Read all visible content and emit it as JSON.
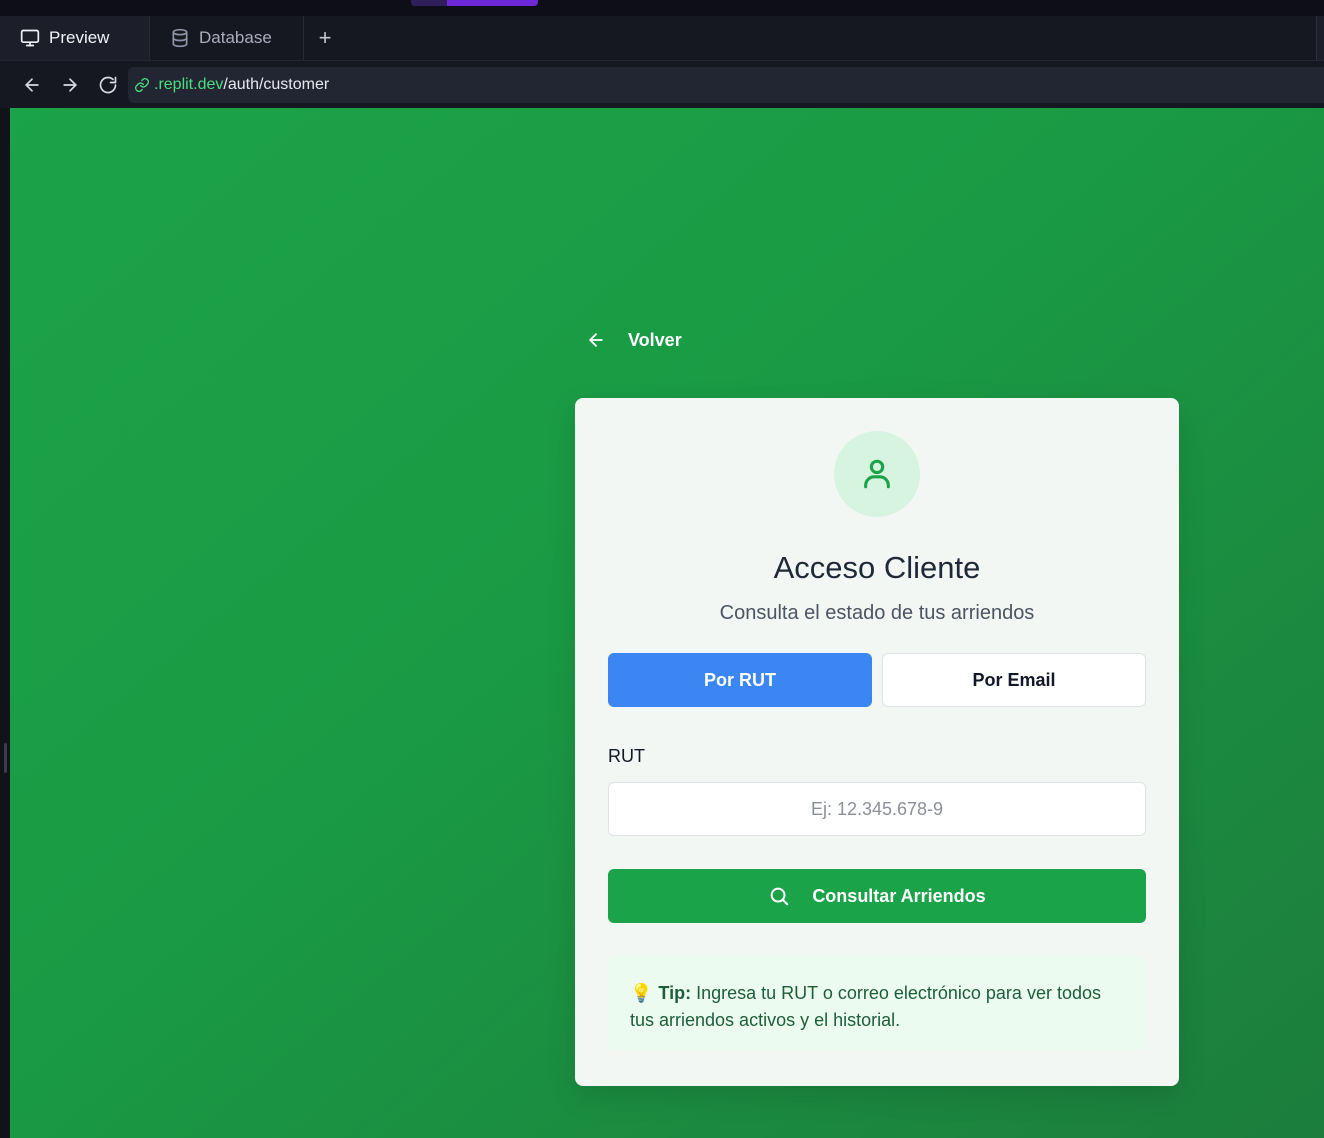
{
  "browser": {
    "tabs": [
      {
        "label": "Preview",
        "icon": "monitor-icon",
        "active": true
      },
      {
        "label": "Database",
        "icon": "database-icon",
        "active": false
      }
    ],
    "add_tab_label": "+",
    "url": {
      "host": ".replit.dev",
      "path": "/auth/customer"
    }
  },
  "page": {
    "back_label": "Volver",
    "title": "Acceso Cliente",
    "subtitle": "Consulta el estado de tus arriendos",
    "toggle": {
      "rut_label": "Por RUT",
      "email_label": "Por Email",
      "selected": "Por RUT"
    },
    "field_label": "RUT",
    "rut_placeholder": "Ej: 12.345.678-9",
    "rut_value": "",
    "submit_label": "Consultar Arriendos",
    "tip": {
      "icon": "💡",
      "label": "Tip:",
      "text": "Ingresa tu RUT o correo electrónico para ver todos tus arriendos activos y el historial."
    }
  },
  "colors": {
    "background_green": "#1ba349",
    "primary_blue": "#3b86f2",
    "button_green": "#1ba349",
    "url_host_green": "#4ade80"
  }
}
